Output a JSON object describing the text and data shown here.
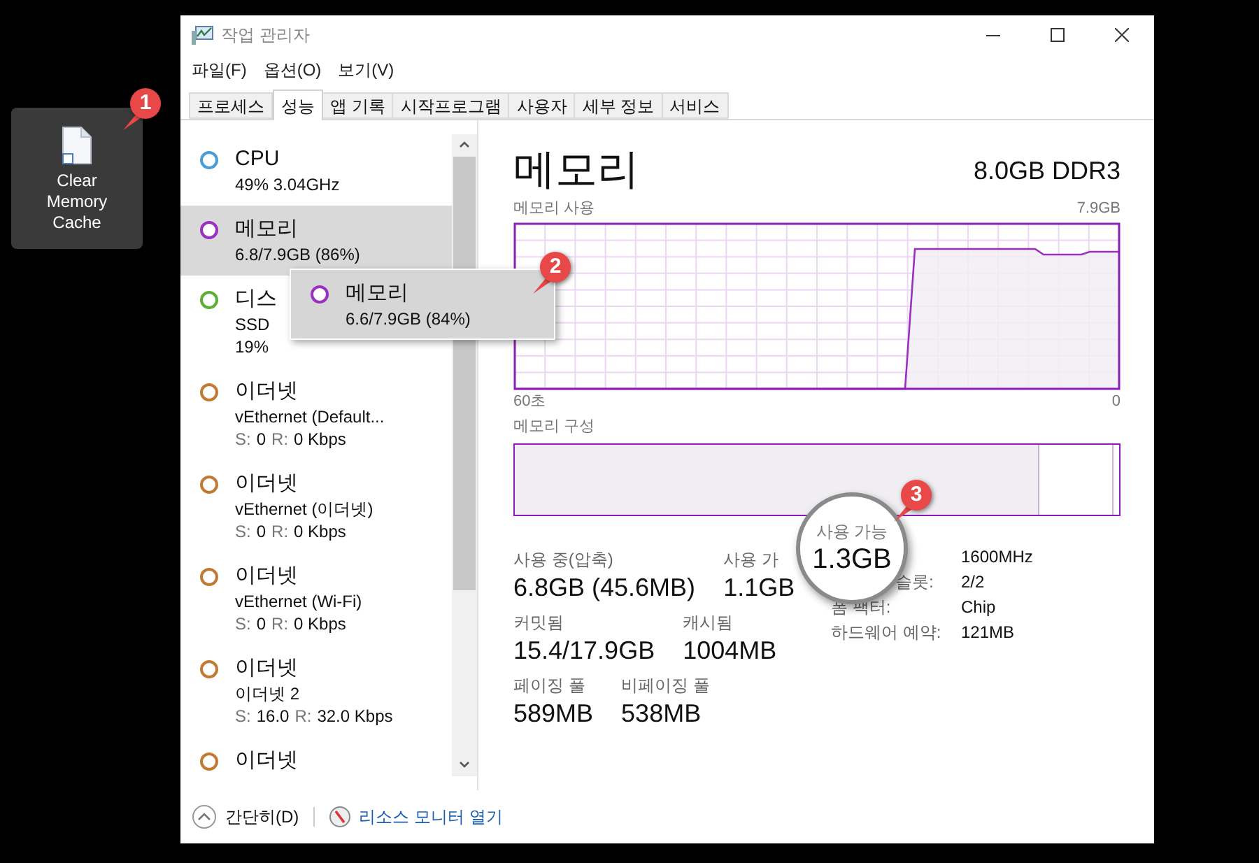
{
  "desktop_icon": {
    "label": "Clear Memory Cache"
  },
  "window": {
    "title": "작업 관리자"
  },
  "menu": [
    "파일(F)",
    "옵션(O)",
    "보기(V)"
  ],
  "tabs": [
    {
      "label": "프로세스",
      "selected": false
    },
    {
      "label": "성능",
      "selected": true
    },
    {
      "label": "앱 기록",
      "selected": false
    },
    {
      "label": "시작프로그램",
      "selected": false
    },
    {
      "label": "사용자",
      "selected": false
    },
    {
      "label": "세부 정보",
      "selected": false
    },
    {
      "label": "서비스",
      "selected": false
    }
  ],
  "sidebar": {
    "items": [
      {
        "title": "CPU",
        "color": "#4a9bd6",
        "selected": false,
        "lines": [
          {
            "kind": "text",
            "text": "49% 3.04GHz"
          }
        ]
      },
      {
        "title": "메모리",
        "color": "#9b2fc0",
        "selected": true,
        "lines": [
          {
            "kind": "text",
            "text": "6.8/7.9GB (86%)"
          }
        ]
      },
      {
        "title": "디스",
        "color": "#5daf33",
        "selected": false,
        "lines": [
          {
            "kind": "text",
            "text": "SSD"
          },
          {
            "kind": "text",
            "text": "19%"
          }
        ]
      },
      {
        "title": "이더넷",
        "color": "#c27a32",
        "selected": false,
        "lines": [
          {
            "kind": "text",
            "text": "vEthernet (Default..."
          },
          {
            "kind": "rate",
            "send_label": "S:",
            "send": "0",
            "recv_label": "R:",
            "recv": "0 Kbps"
          }
        ]
      },
      {
        "title": "이더넷",
        "color": "#c27a32",
        "selected": false,
        "lines": [
          {
            "kind": "text",
            "text": "vEthernet (이더넷)"
          },
          {
            "kind": "rate",
            "send_label": "S:",
            "send": "0",
            "recv_label": "R:",
            "recv": "0 Kbps"
          }
        ]
      },
      {
        "title": "이더넷",
        "color": "#c27a32",
        "selected": false,
        "lines": [
          {
            "kind": "text",
            "text": "vEthernet (Wi-Fi)"
          },
          {
            "kind": "rate",
            "send_label": "S:",
            "send": "0",
            "recv_label": "R:",
            "recv": "0 Kbps"
          }
        ]
      },
      {
        "title": "이더넷",
        "color": "#c27a32",
        "selected": false,
        "lines": [
          {
            "kind": "text",
            "text": "이더넷 2"
          },
          {
            "kind": "rate",
            "send_label": "S:",
            "send": "16.0",
            "recv_label": "R:",
            "recv": "32.0 Kbps"
          }
        ]
      },
      {
        "title": "이더넷",
        "color": "#c27a32",
        "selected": false
      }
    ]
  },
  "popup": {
    "title": "메모리",
    "subtitle": "6.6/7.9GB (84%)",
    "color": "#9b2fc0"
  },
  "detail": {
    "title": "메모리",
    "spec": "8.0GB DDR3",
    "usage_label": "메모리 사용",
    "usage_max": "7.9GB",
    "time_start": "60초",
    "time_end": "0",
    "composition_label": "메모리 구성",
    "stat_rows": [
      [
        {
          "label": "사용 중(압축)",
          "value": "6.8GB (45.6MB)"
        },
        {
          "label": "사용 가",
          "value": "1.1GB"
        }
      ],
      [
        {
          "label": "커밋됨",
          "value": "15.4/17.9GB"
        },
        {
          "label": "캐시됨",
          "value": "1004MB"
        }
      ],
      [
        {
          "label": "페이징 풀",
          "value": "589MB"
        },
        {
          "label": "비페이징 풀",
          "value": "538MB"
        }
      ]
    ],
    "specs": [
      {
        "value": "1600MHz"
      },
      {
        "kind": "cut",
        "label": "슬롯:",
        "value": "2/2"
      },
      {
        "kind": "full",
        "label": "폼 팩터:",
        "value": "Chip"
      },
      {
        "kind": "full",
        "label": "하드웨어 예약:",
        "value": "121MB"
      }
    ]
  },
  "magnifier": {
    "label": "사용 가능",
    "value": "1.3GB"
  },
  "footer": {
    "collapse": "간단히(D)",
    "link": "리소스 모니터 열기"
  },
  "callouts": [
    "1",
    "2",
    "3"
  ]
}
